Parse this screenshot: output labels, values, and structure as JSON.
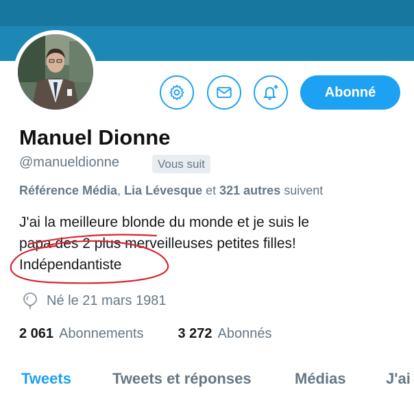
{
  "profile": {
    "name": "Manuel Dionne",
    "handle": "@manueldionne",
    "follows_you": "Vous suit",
    "follow_button": "Abonné"
  },
  "followed_by": {
    "user1": "Référence Média",
    "sep1": ", ",
    "user2": "Lia Lévesque",
    "sep2": " et ",
    "others": "321 autres",
    "suffix": " suivent"
  },
  "bio": {
    "lines": [
      "J'ai la meilleure blonde du monde et je suis le",
      "papa des 2 plus merveilleuses petites filles!",
      "Indépendantiste"
    ]
  },
  "birth": {
    "text": "Né le 21 mars 1981",
    "icon": "balloon-icon"
  },
  "stats": {
    "following_count": "2 061",
    "following_label": "Abonnements",
    "followers_count": "3 272",
    "followers_label": "Abonnés"
  },
  "tabs": [
    {
      "label": "Tweets",
      "active": true
    },
    {
      "label": "Tweets et réponses",
      "active": false
    },
    {
      "label": "Médias",
      "active": false
    },
    {
      "label": "J'ai",
      "active": false
    }
  ],
  "icons": {
    "settings": "gear-icon",
    "message": "envelope-icon",
    "notifications": "bell-plus-icon"
  },
  "colors": {
    "banner": "#1d87b5",
    "accent": "#1da1f2",
    "annotation": "#d9232e"
  }
}
